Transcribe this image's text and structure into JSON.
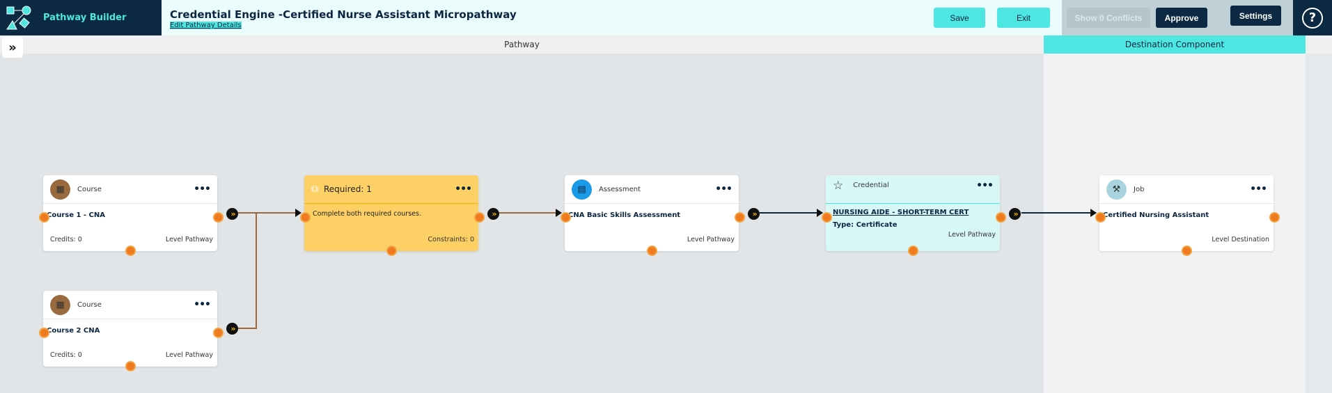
{
  "app": {
    "name": "Pathway Builder"
  },
  "header": {
    "title": "Credential Engine -Certified Nurse Assistant Micropathway",
    "edit_link": "Edit Pathway Details",
    "save": "Save",
    "exit": "Exit",
    "conflicts": "Show 0 Conflicts",
    "approve": "Approve",
    "settings": "Settings",
    "help": "?"
  },
  "sections": {
    "pathway": "Pathway",
    "destination": "Destination Component"
  },
  "cards": {
    "course1": {
      "type": "Course",
      "name": "Course 1 - CNA",
      "credits": "Credits: 0",
      "level": "Level Pathway"
    },
    "course2": {
      "type": "Course",
      "name": "Course 2 CNA",
      "credits": "Credits: 0",
      "level": "Level Pathway"
    },
    "required": {
      "title": "Required: 1",
      "desc": "Complete both required courses.",
      "constraints": "Constraints: 0"
    },
    "assessment": {
      "type": "Assessment",
      "name": "CNA Basic Skills Assessment",
      "level": "Level Pathway"
    },
    "credential": {
      "type": "Credential",
      "name": "NURSING AIDE - SHORT-TERM CERT",
      "subtype": "Type: Certificate",
      "level": "Level Pathway"
    },
    "job": {
      "type": "Job",
      "name": "Certified Nursing Assistant",
      "level": "Level Destination"
    }
  },
  "colors": {
    "brand": "#0b2942",
    "accent": "#4de6e0",
    "required": "#fdd065",
    "credential": "#d8f8f8",
    "port": "#f07a20",
    "brown_line": "#a0683a"
  }
}
